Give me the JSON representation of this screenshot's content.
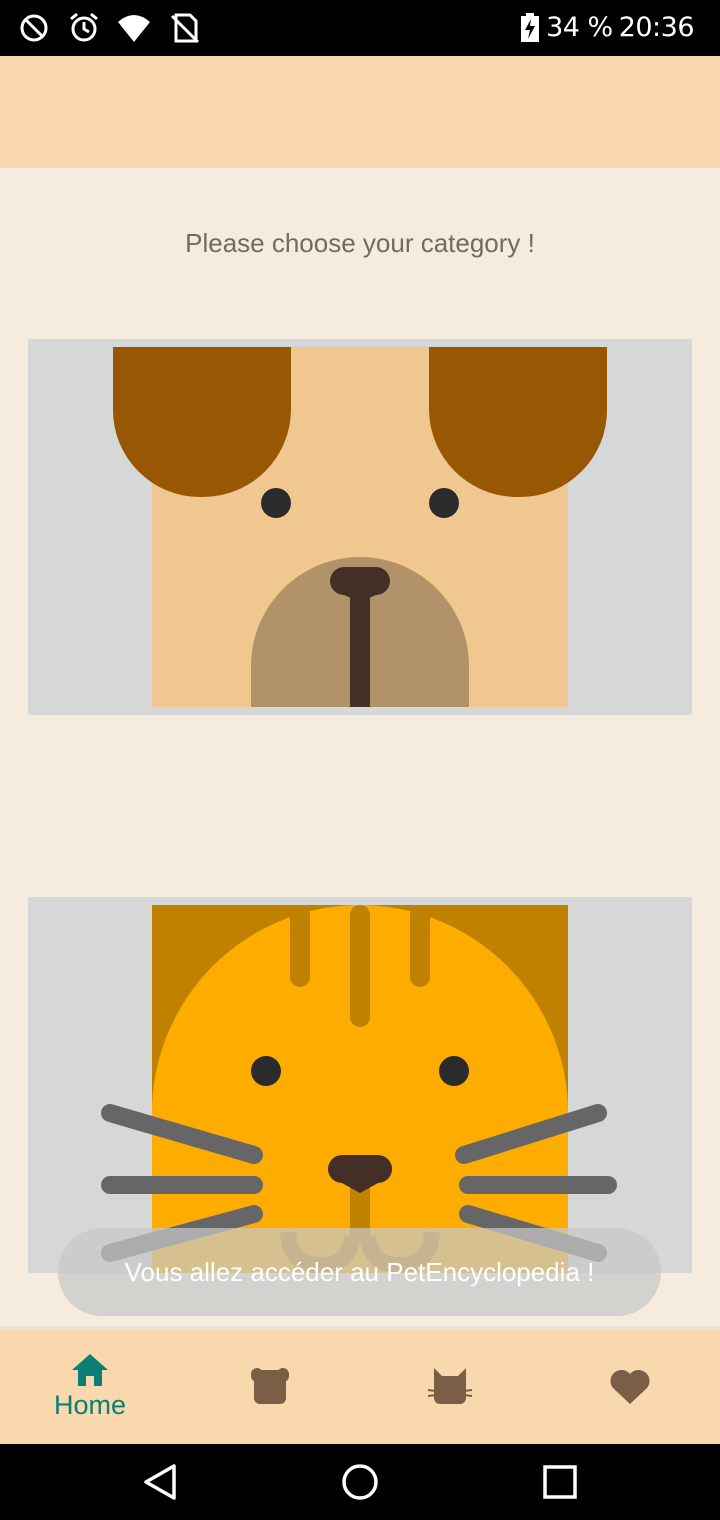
{
  "status_bar": {
    "battery": "34 %",
    "time": "20:36"
  },
  "main": {
    "subtitle": "Please choose your category !",
    "cards": [
      {
        "name": "dog"
      },
      {
        "name": "cat"
      }
    ]
  },
  "toast": {
    "message": "Vous allez accéder au PetEncyclopedia !"
  },
  "bottom_nav": {
    "items": [
      {
        "label": "Home",
        "icon": "home-icon",
        "active": true
      },
      {
        "label": "",
        "icon": "dog-icon",
        "active": false
      },
      {
        "label": "",
        "icon": "cat-icon",
        "active": false
      },
      {
        "label": "",
        "icon": "heart-icon",
        "active": false
      }
    ],
    "active_color": "#0b7f76",
    "inactive_color": "#7b5e48"
  },
  "colors": {
    "app_bar": "#f8d8ac",
    "background": "#f5ebdf",
    "card": "#d6d8d8"
  }
}
